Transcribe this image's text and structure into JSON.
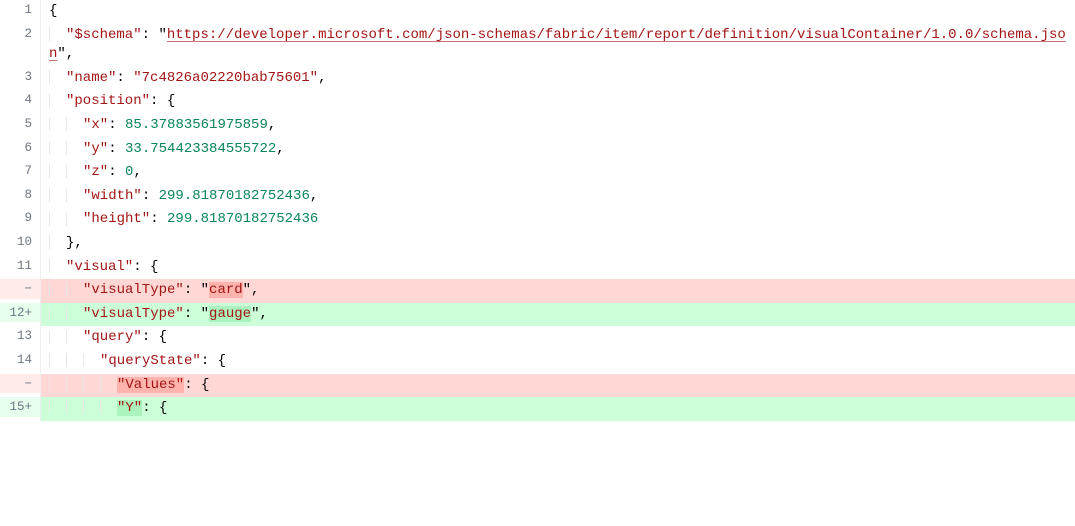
{
  "lines": [
    {
      "num": "1",
      "indent": 0,
      "tokens": [
        {
          "cls": "brace",
          "t": "{"
        }
      ]
    },
    {
      "num": "2",
      "indent": 1,
      "tokens": [
        {
          "cls": "key",
          "t": "\"$schema\""
        },
        {
          "cls": "punct",
          "t": ": "
        },
        {
          "cls": "punct",
          "t": "\""
        },
        {
          "cls": "url",
          "t": "https://developer.microsoft.com/json-schemas/fabric/item/report/definition/visualContainer/1.0.0/schema.json"
        },
        {
          "cls": "punct",
          "t": "\","
        }
      ]
    },
    {
      "num": "3",
      "indent": 1,
      "tokens": [
        {
          "cls": "key",
          "t": "\"name\""
        },
        {
          "cls": "punct",
          "t": ": "
        },
        {
          "cls": "string",
          "t": "\"7c4826a02220bab75601\""
        },
        {
          "cls": "punct",
          "t": ","
        }
      ]
    },
    {
      "num": "4",
      "indent": 1,
      "tokens": [
        {
          "cls": "key",
          "t": "\"position\""
        },
        {
          "cls": "punct",
          "t": ": "
        },
        {
          "cls": "brace",
          "t": "{"
        }
      ]
    },
    {
      "num": "5",
      "indent": 2,
      "tokens": [
        {
          "cls": "key",
          "t": "\"x\""
        },
        {
          "cls": "punct",
          "t": ": "
        },
        {
          "cls": "number",
          "t": "85.37883561975859"
        },
        {
          "cls": "punct",
          "t": ","
        }
      ]
    },
    {
      "num": "6",
      "indent": 2,
      "tokens": [
        {
          "cls": "key",
          "t": "\"y\""
        },
        {
          "cls": "punct",
          "t": ": "
        },
        {
          "cls": "number",
          "t": "33.754423384555722"
        },
        {
          "cls": "punct",
          "t": ","
        }
      ]
    },
    {
      "num": "7",
      "indent": 2,
      "tokens": [
        {
          "cls": "key",
          "t": "\"z\""
        },
        {
          "cls": "punct",
          "t": ": "
        },
        {
          "cls": "number",
          "t": "0"
        },
        {
          "cls": "punct",
          "t": ","
        }
      ]
    },
    {
      "num": "8",
      "indent": 2,
      "tokens": [
        {
          "cls": "key",
          "t": "\"width\""
        },
        {
          "cls": "punct",
          "t": ": "
        },
        {
          "cls": "number",
          "t": "299.81870182752436"
        },
        {
          "cls": "punct",
          "t": ","
        }
      ]
    },
    {
      "num": "9",
      "indent": 2,
      "tokens": [
        {
          "cls": "key",
          "t": "\"height\""
        },
        {
          "cls": "punct",
          "t": ": "
        },
        {
          "cls": "number",
          "t": "299.81870182752436"
        }
      ]
    },
    {
      "num": "10",
      "indent": 1,
      "tokens": [
        {
          "cls": "brace",
          "t": "}"
        },
        {
          "cls": "punct",
          "t": ","
        }
      ]
    },
    {
      "num": "11",
      "indent": 1,
      "tokens": [
        {
          "cls": "key",
          "t": "\"visual\""
        },
        {
          "cls": "punct",
          "t": ": "
        },
        {
          "cls": "brace",
          "t": "{"
        }
      ]
    },
    {
      "num": "−",
      "indent": 2,
      "type": "removal",
      "tokens": [
        {
          "cls": "key",
          "t": "\"visualType\""
        },
        {
          "cls": "punct",
          "t": ": "
        },
        {
          "cls": "punct",
          "t": "\""
        },
        {
          "cls": "string hl-removed",
          "t": "card"
        },
        {
          "cls": "punct",
          "t": "\","
        }
      ]
    },
    {
      "num": "12+",
      "indent": 2,
      "type": "addition",
      "tokens": [
        {
          "cls": "key",
          "t": "\"visualType\""
        },
        {
          "cls": "punct",
          "t": ": "
        },
        {
          "cls": "punct",
          "t": "\""
        },
        {
          "cls": "string hl-added",
          "t": "gauge"
        },
        {
          "cls": "punct",
          "t": "\","
        }
      ]
    },
    {
      "num": "13",
      "indent": 2,
      "tokens": [
        {
          "cls": "key",
          "t": "\"query\""
        },
        {
          "cls": "punct",
          "t": ": "
        },
        {
          "cls": "brace",
          "t": "{"
        }
      ]
    },
    {
      "num": "14",
      "indent": 3,
      "tokens": [
        {
          "cls": "key",
          "t": "\"queryState\""
        },
        {
          "cls": "punct",
          "t": ": "
        },
        {
          "cls": "brace",
          "t": "{"
        }
      ]
    },
    {
      "num": "−",
      "indent": 4,
      "type": "removal",
      "tokens": [
        {
          "cls": "key hl-removed",
          "t": "\"Values\""
        },
        {
          "cls": "punct",
          "t": ": "
        },
        {
          "cls": "brace",
          "t": "{"
        }
      ]
    },
    {
      "num": "15+",
      "indent": 4,
      "type": "addition",
      "tokens": [
        {
          "cls": "key hl-added",
          "t": "\"Y\""
        },
        {
          "cls": "punct",
          "t": ": "
        },
        {
          "cls": "brace",
          "t": "{"
        }
      ]
    }
  ]
}
